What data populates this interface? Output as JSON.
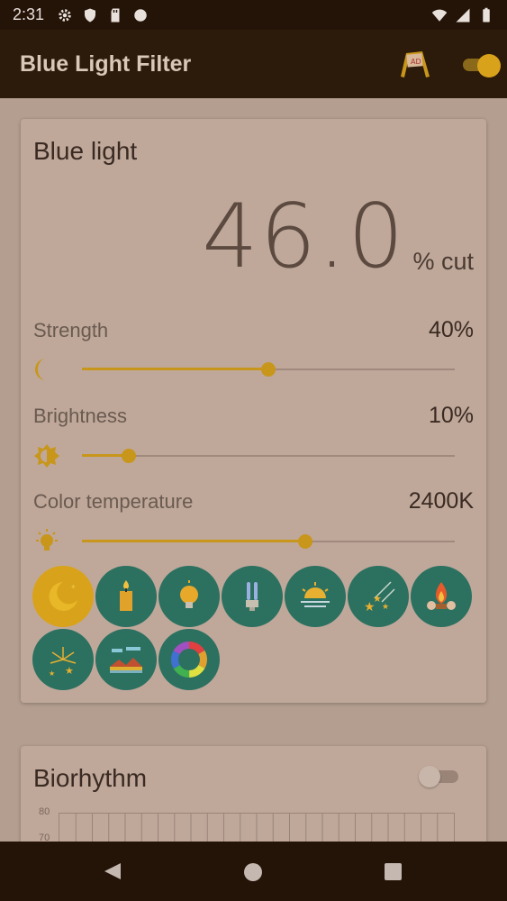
{
  "status_bar": {
    "time": "2:31",
    "icons": [
      "gear-icon",
      "shield-icon",
      "sd-card-icon",
      "circle-icon",
      "wifi-icon",
      "signal-icon",
      "battery-icon"
    ]
  },
  "app_bar": {
    "title": "Blue Light Filter",
    "ad_label": "AD",
    "filter_toggle_on": true
  },
  "blue_light": {
    "title": "Blue light",
    "cut_value": "46.0",
    "cut_unit": "% cut",
    "strength": {
      "label": "Strength",
      "value": "40%",
      "fraction": 0.5
    },
    "brightness": {
      "label": "Brightness",
      "value": "10%",
      "fraction": 0.125
    },
    "color_temperature": {
      "label": "Color temperature",
      "value": "2400K",
      "fraction": 0.6
    },
    "presets": [
      {
        "name": "moon-icon",
        "active": true
      },
      {
        "name": "candle-icon",
        "active": false
      },
      {
        "name": "bulb-icon",
        "active": false
      },
      {
        "name": "fluorescent-icon",
        "active": false
      },
      {
        "name": "sunset-icon",
        "active": false
      },
      {
        "name": "shooting-stars-icon",
        "active": false
      },
      {
        "name": "campfire-icon",
        "active": false
      },
      {
        "name": "fireworks-icon",
        "active": false
      },
      {
        "name": "landscape-icon",
        "active": false
      },
      {
        "name": "color-wheel-icon",
        "active": false
      }
    ]
  },
  "biorhythm": {
    "title": "Biorhythm",
    "toggle_on": false,
    "y_labels": [
      "80",
      "70"
    ]
  },
  "colors": {
    "accent": "#d9a21b",
    "preset_bg": "#2c7060",
    "card_bg": "#bfa89a",
    "app_bar": "#2c1a0b"
  }
}
